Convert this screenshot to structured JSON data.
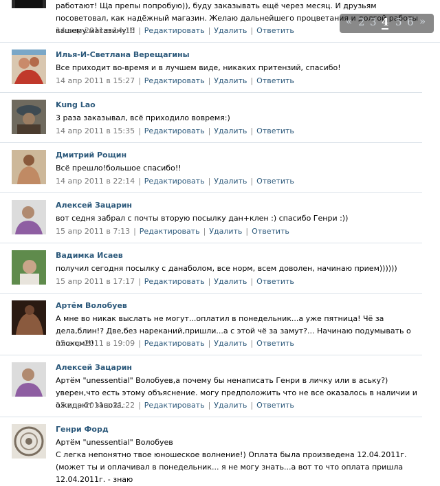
{
  "labels": {
    "edit": "Редактировать",
    "delete": "Удалить",
    "reply": "Ответить",
    "separator": "|"
  },
  "pager": {
    "prev": "«",
    "pages": [
      "2",
      "3",
      "4",
      "5",
      "6"
    ],
    "current": "4",
    "next": "»"
  },
  "posts": [
    {
      "author": "",
      "text": "работают! Ща препы попробую)), буду заказывать ещё через месяц. И друзьям посоветовал, как надёжный магазин. Желаю дальнейшего процветания и долгой работы вашему магазину!!!",
      "date": "14 апр 2011 в 14:16"
    },
    {
      "author": "Илья-И-Светлана Верещагины",
      "text": "Все приходит во-время и в лучшем виде, никаких притензий, спасибо!",
      "date": "14 апр 2011 в 15:27"
    },
    {
      "author": "Kung Lao",
      "text": "3 раза заказывал, всё приходило вовремя:)",
      "date": "14 апр 2011 в 15:35"
    },
    {
      "author": "Дмитрий Рощин",
      "text": "Всё прешло!большое спасибо!!",
      "date": "14 апр 2011 в 22:14"
    },
    {
      "author": "Алексей Зацарин",
      "text": "вот седня забрал с почты вторую посылку дан+клен :) спасибо Генри :))",
      "date": "15 апр 2011 в 7:13"
    },
    {
      "author": "Вадимка Исаев",
      "text": "получил сегодня посылку с данаболом, все норм, всем доволен, начинаю прием))))))",
      "date": "15 апр 2011 в 17:17"
    },
    {
      "author": "Артём Волобуев",
      "text": "А мне во никак выслать не могут...оплатил в понедельник...а уже пятница! Чё за дела,блин!? Две,без нареканий,пришли...а с этой чё за замут?... Начинаю подумывать о плохом!!!",
      "date": "15 апр 2011 в 19:09"
    },
    {
      "author": "Алексей Зацарин",
      "text": "Артём \"unessential\" Волобуев,а почему бы ненаписать Генри в личку или в аську?) уверен,что есть этому объяснение. могу предположить что не все оказалось в наличии и ожидают завоза.",
      "date": "15 апр 2011 в 21:22"
    },
    {
      "author": "Генри Форд",
      "text": "Артём \"unessential\" Волобуев",
      "text2": "С легка непонятно твое юношеское волнение!) Оплата была произведена 12.04.2011г. (может ты и оплачивал в понедельник... я не могу знать...а вот то что оплата пришла 12.04.2011г. - знаю",
      "date": ""
    }
  ]
}
